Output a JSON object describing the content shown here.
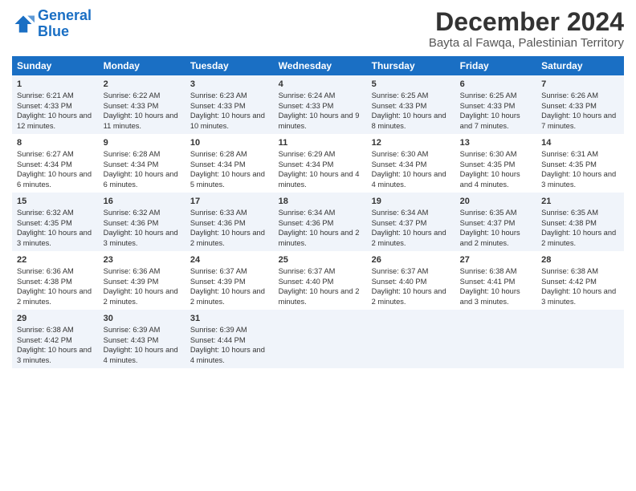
{
  "logo": {
    "line1": "General",
    "line2": "Blue"
  },
  "title": "December 2024",
  "subtitle": "Bayta al Fawqa, Palestinian Territory",
  "days_header": [
    "Sunday",
    "Monday",
    "Tuesday",
    "Wednesday",
    "Thursday",
    "Friday",
    "Saturday"
  ],
  "weeks": [
    [
      {
        "day": "1",
        "sunrise": "Sunrise: 6:21 AM",
        "sunset": "Sunset: 4:33 PM",
        "daylight": "Daylight: 10 hours and 12 minutes."
      },
      {
        "day": "2",
        "sunrise": "Sunrise: 6:22 AM",
        "sunset": "Sunset: 4:33 PM",
        "daylight": "Daylight: 10 hours and 11 minutes."
      },
      {
        "day": "3",
        "sunrise": "Sunrise: 6:23 AM",
        "sunset": "Sunset: 4:33 PM",
        "daylight": "Daylight: 10 hours and 10 minutes."
      },
      {
        "day": "4",
        "sunrise": "Sunrise: 6:24 AM",
        "sunset": "Sunset: 4:33 PM",
        "daylight": "Daylight: 10 hours and 9 minutes."
      },
      {
        "day": "5",
        "sunrise": "Sunrise: 6:25 AM",
        "sunset": "Sunset: 4:33 PM",
        "daylight": "Daylight: 10 hours and 8 minutes."
      },
      {
        "day": "6",
        "sunrise": "Sunrise: 6:25 AM",
        "sunset": "Sunset: 4:33 PM",
        "daylight": "Daylight: 10 hours and 7 minutes."
      },
      {
        "day": "7",
        "sunrise": "Sunrise: 6:26 AM",
        "sunset": "Sunset: 4:33 PM",
        "daylight": "Daylight: 10 hours and 7 minutes."
      }
    ],
    [
      {
        "day": "8",
        "sunrise": "Sunrise: 6:27 AM",
        "sunset": "Sunset: 4:34 PM",
        "daylight": "Daylight: 10 hours and 6 minutes."
      },
      {
        "day": "9",
        "sunrise": "Sunrise: 6:28 AM",
        "sunset": "Sunset: 4:34 PM",
        "daylight": "Daylight: 10 hours and 6 minutes."
      },
      {
        "day": "10",
        "sunrise": "Sunrise: 6:28 AM",
        "sunset": "Sunset: 4:34 PM",
        "daylight": "Daylight: 10 hours and 5 minutes."
      },
      {
        "day": "11",
        "sunrise": "Sunrise: 6:29 AM",
        "sunset": "Sunset: 4:34 PM",
        "daylight": "Daylight: 10 hours and 4 minutes."
      },
      {
        "day": "12",
        "sunrise": "Sunrise: 6:30 AM",
        "sunset": "Sunset: 4:34 PM",
        "daylight": "Daylight: 10 hours and 4 minutes."
      },
      {
        "day": "13",
        "sunrise": "Sunrise: 6:30 AM",
        "sunset": "Sunset: 4:35 PM",
        "daylight": "Daylight: 10 hours and 4 minutes."
      },
      {
        "day": "14",
        "sunrise": "Sunrise: 6:31 AM",
        "sunset": "Sunset: 4:35 PM",
        "daylight": "Daylight: 10 hours and 3 minutes."
      }
    ],
    [
      {
        "day": "15",
        "sunrise": "Sunrise: 6:32 AM",
        "sunset": "Sunset: 4:35 PM",
        "daylight": "Daylight: 10 hours and 3 minutes."
      },
      {
        "day": "16",
        "sunrise": "Sunrise: 6:32 AM",
        "sunset": "Sunset: 4:36 PM",
        "daylight": "Daylight: 10 hours and 3 minutes."
      },
      {
        "day": "17",
        "sunrise": "Sunrise: 6:33 AM",
        "sunset": "Sunset: 4:36 PM",
        "daylight": "Daylight: 10 hours and 2 minutes."
      },
      {
        "day": "18",
        "sunrise": "Sunrise: 6:34 AM",
        "sunset": "Sunset: 4:36 PM",
        "daylight": "Daylight: 10 hours and 2 minutes."
      },
      {
        "day": "19",
        "sunrise": "Sunrise: 6:34 AM",
        "sunset": "Sunset: 4:37 PM",
        "daylight": "Daylight: 10 hours and 2 minutes."
      },
      {
        "day": "20",
        "sunrise": "Sunrise: 6:35 AM",
        "sunset": "Sunset: 4:37 PM",
        "daylight": "Daylight: 10 hours and 2 minutes."
      },
      {
        "day": "21",
        "sunrise": "Sunrise: 6:35 AM",
        "sunset": "Sunset: 4:38 PM",
        "daylight": "Daylight: 10 hours and 2 minutes."
      }
    ],
    [
      {
        "day": "22",
        "sunrise": "Sunrise: 6:36 AM",
        "sunset": "Sunset: 4:38 PM",
        "daylight": "Daylight: 10 hours and 2 minutes."
      },
      {
        "day": "23",
        "sunrise": "Sunrise: 6:36 AM",
        "sunset": "Sunset: 4:39 PM",
        "daylight": "Daylight: 10 hours and 2 minutes."
      },
      {
        "day": "24",
        "sunrise": "Sunrise: 6:37 AM",
        "sunset": "Sunset: 4:39 PM",
        "daylight": "Daylight: 10 hours and 2 minutes."
      },
      {
        "day": "25",
        "sunrise": "Sunrise: 6:37 AM",
        "sunset": "Sunset: 4:40 PM",
        "daylight": "Daylight: 10 hours and 2 minutes."
      },
      {
        "day": "26",
        "sunrise": "Sunrise: 6:37 AM",
        "sunset": "Sunset: 4:40 PM",
        "daylight": "Daylight: 10 hours and 2 minutes."
      },
      {
        "day": "27",
        "sunrise": "Sunrise: 6:38 AM",
        "sunset": "Sunset: 4:41 PM",
        "daylight": "Daylight: 10 hours and 3 minutes."
      },
      {
        "day": "28",
        "sunrise": "Sunrise: 6:38 AM",
        "sunset": "Sunset: 4:42 PM",
        "daylight": "Daylight: 10 hours and 3 minutes."
      }
    ],
    [
      {
        "day": "29",
        "sunrise": "Sunrise: 6:38 AM",
        "sunset": "Sunset: 4:42 PM",
        "daylight": "Daylight: 10 hours and 3 minutes."
      },
      {
        "day": "30",
        "sunrise": "Sunrise: 6:39 AM",
        "sunset": "Sunset: 4:43 PM",
        "daylight": "Daylight: 10 hours and 4 minutes."
      },
      {
        "day": "31",
        "sunrise": "Sunrise: 6:39 AM",
        "sunset": "Sunset: 4:44 PM",
        "daylight": "Daylight: 10 hours and 4 minutes."
      },
      null,
      null,
      null,
      null
    ]
  ]
}
